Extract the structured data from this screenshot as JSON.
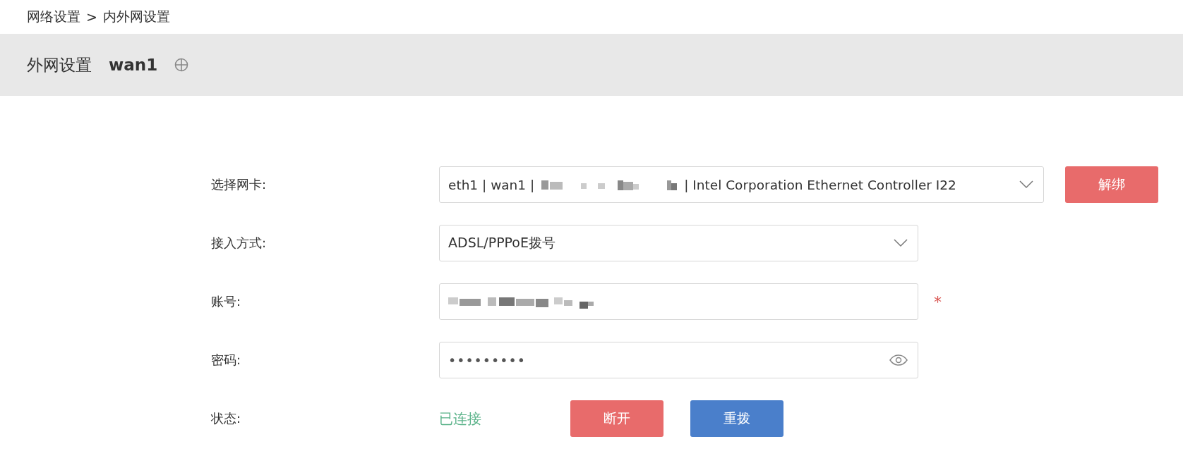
{
  "breadcrumb": {
    "items": [
      "网络设置",
      "内外网设置"
    ],
    "separator": ">"
  },
  "header": {
    "title": "外网设置",
    "interface": "wan1"
  },
  "form": {
    "rows": [
      {
        "kind": "select-button",
        "label": "选择网卡:",
        "value_start": "eth1 | wan1 |",
        "value_end": "| Intel Corporation Ethernet Controller I22",
        "button": "解绑"
      },
      {
        "kind": "select",
        "label": "接入方式:",
        "value": "ADSL/PPPoE拨号"
      },
      {
        "kind": "account",
        "label": "账号:",
        "required_mark": "*"
      },
      {
        "kind": "password",
        "label": "密码:",
        "value": "•••••••••"
      },
      {
        "kind": "status",
        "label": "状态:",
        "status": "已连接",
        "buttons": [
          {
            "label": "断开",
            "color": "#e86b6b"
          },
          {
            "label": "重拨",
            "color": "#4a7fcb"
          }
        ]
      }
    ]
  }
}
